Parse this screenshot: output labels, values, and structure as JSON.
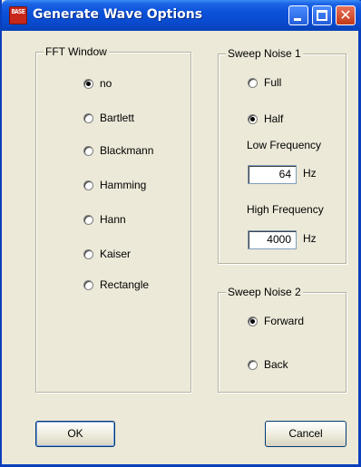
{
  "window": {
    "title": "Generate Wave Options",
    "icon_text": "BASE",
    "close_glyph": "✕"
  },
  "fft_window": {
    "title": "FFT Window",
    "options": [
      {
        "label": "no",
        "checked": true
      },
      {
        "label": "Bartlett",
        "checked": false
      },
      {
        "label": "Blackmann",
        "checked": false
      },
      {
        "label": "Hamming",
        "checked": false
      },
      {
        "label": "Hann",
        "checked": false
      },
      {
        "label": "Kaiser",
        "checked": false
      },
      {
        "label": "Rectangle",
        "checked": false
      }
    ]
  },
  "sweep_noise_1": {
    "title": "Sweep Noise 1",
    "options": [
      {
        "label": "Full",
        "checked": false
      },
      {
        "label": "Half",
        "checked": true
      }
    ],
    "low_frequency": {
      "label": "Low Frequency",
      "value": "64",
      "unit": "Hz"
    },
    "high_frequency": {
      "label": "High Frequency",
      "value": "4000",
      "unit": "Hz"
    }
  },
  "sweep_noise_2": {
    "title": "Sweep Noise 2",
    "options": [
      {
        "label": "Forward",
        "checked": true
      },
      {
        "label": "Back",
        "checked": false
      }
    ]
  },
  "buttons": {
    "ok": "OK",
    "cancel": "Cancel"
  },
  "colors": {
    "titlebar": "#0a4bd0",
    "dialog_bg": "#ece9d8",
    "close_button": "#c23a18"
  }
}
